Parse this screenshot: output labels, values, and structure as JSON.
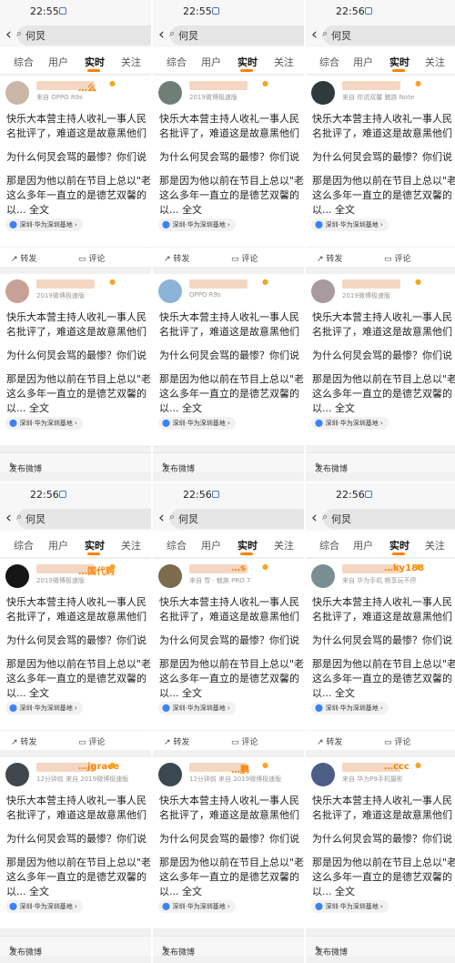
{
  "status_time_top": [
    "22:55",
    "22:55",
    "22:56"
  ],
  "status_time_bottom": [
    "22:56",
    "22:56",
    "22:56"
  ],
  "search_query": "何炅",
  "tabs": [
    "综合",
    "用户",
    "实时",
    "关注"
  ],
  "post_lines": [
    "快乐大本营主持人收礼一事人民",
    "名批评了，难道这是故意黑他们",
    "为什么何炅会骂的最惨？你们说",
    "那是因为他以前在节目上总以\"老",
    "这么多年一直立的是德艺双馨的",
    "以... 全文"
  ],
  "location": "深圳·华为深圳基地",
  "actions": {
    "repost": "转发",
    "comment": "评论"
  },
  "compose": "发布微博",
  "users": [
    {
      "name": "…么",
      "meta": "来自 OPPO R9s"
    },
    {
      "name": "",
      "meta": "2019微博极速版"
    },
    {
      "name": "",
      "meta": "来自 你说双馨 魅族 Note"
    },
    {
      "name": "",
      "meta": "2019微博极速版"
    },
    {
      "name": "",
      "meta": "OPPO R9s"
    },
    {
      "name": "",
      "meta": "2019微博极速版"
    },
    {
      "name": "…国代购",
      "meta": "2019微博极速版"
    },
    {
      "name": "…s",
      "meta": "来自 雪 · 魅族 PRO 7"
    },
    {
      "name": "…ky188",
      "meta": "来自 华为手机 畅享玩不停"
    },
    {
      "name": "…jgrace",
      "meta": "12分钟前 来自 2019微博极速版"
    },
    {
      "name": "…鹏",
      "meta": "12分钟前 来自 2019微博极速版"
    },
    {
      "name": "…ccc",
      "meta": "来自 华为P9手机摄影"
    }
  ],
  "colors": {
    "accent": "#ff8200",
    "pin": "#3b82f6"
  }
}
